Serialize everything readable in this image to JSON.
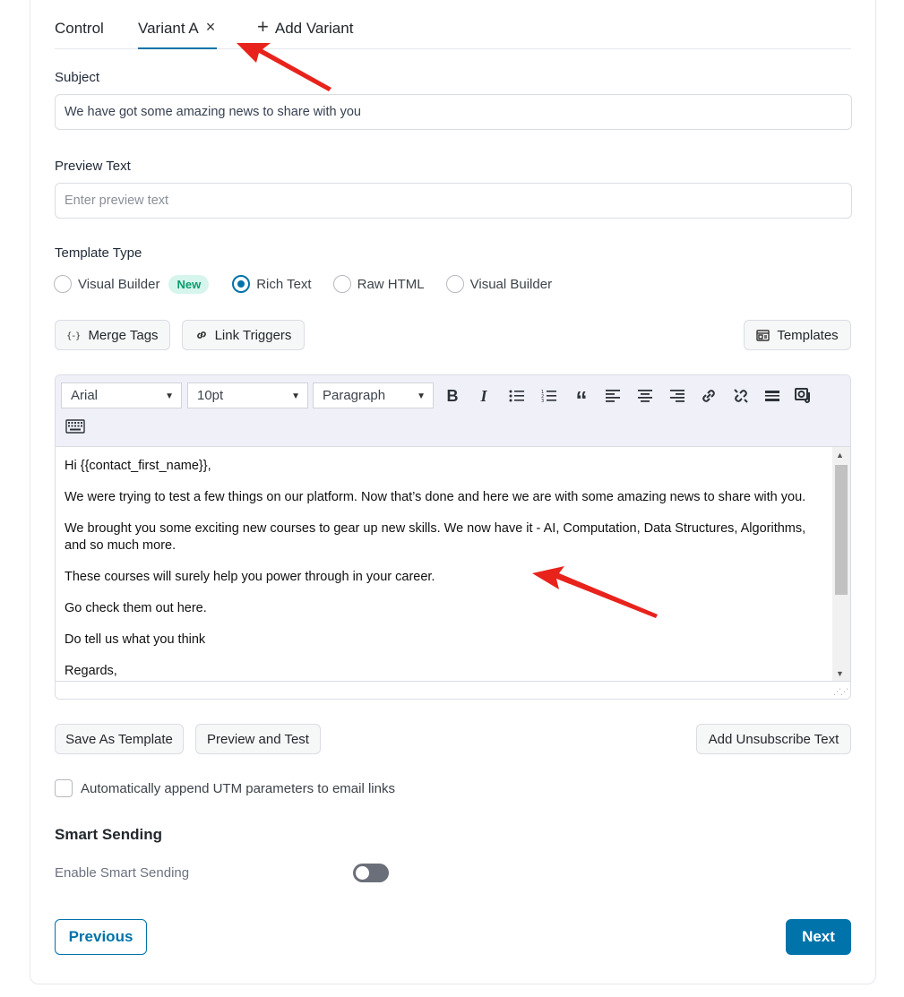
{
  "tabs": {
    "control": "Control",
    "variant_a": "Variant A",
    "close_glyph": "×",
    "add_glyph": "+",
    "add_variant": "Add Variant"
  },
  "subject": {
    "label": "Subject",
    "value": "We have got some amazing news to share with you"
  },
  "preview_text": {
    "label": "Preview Text",
    "placeholder": "Enter preview text",
    "value": ""
  },
  "template_type": {
    "label": "Template Type",
    "options": [
      {
        "label": "Visual Builder",
        "badge": "New",
        "checked": false
      },
      {
        "label": "Rich Text",
        "checked": true
      },
      {
        "label": "Raw HTML",
        "checked": false
      },
      {
        "label": "Visual Builder",
        "checked": false
      }
    ]
  },
  "actions": {
    "merge_tags": "Merge Tags",
    "link_triggers": "Link Triggers",
    "templates": "Templates"
  },
  "editor": {
    "font": "Arial",
    "size": "10pt",
    "block": "Paragraph",
    "toolbar_icons": [
      "bold-icon",
      "italic-icon",
      "bullet-list-icon",
      "numbered-list-icon",
      "blockquote-icon",
      "align-left-icon",
      "align-center-icon",
      "align-right-icon",
      "link-icon",
      "unlink-icon",
      "horizontal-rule-icon",
      "media-icon",
      "keyboard-icon"
    ],
    "paragraphs": [
      "Hi {{contact_first_name}},",
      "We were trying to test a few things on our platform. Now that’s done and here we are with some amazing news to share with you.",
      "We brought you some exciting new courses to gear up new skills. We now have it - AI, Computation, Data Structures, Algorithms, and so much more.",
      "These courses will surely help you power through in your career.",
      "Go check them out here.",
      "Do tell us what you think",
      "Regards,"
    ]
  },
  "bottom_actions": {
    "save_template": "Save As Template",
    "preview_test": "Preview and Test",
    "unsubscribe": "Add Unsubscribe Text"
  },
  "utm": {
    "label": "Automatically append UTM parameters to email links",
    "checked": false
  },
  "smart_sending": {
    "title": "Smart Sending",
    "toggle_label": "Enable Smart Sending",
    "enabled": false
  },
  "nav": {
    "previous": "Previous",
    "next": "Next"
  },
  "colors": {
    "accent": "#0073aa",
    "annotation_arrow": "#e8231c",
    "badge_bg": "#d6f5ec",
    "badge_text": "#0a9c6d"
  }
}
